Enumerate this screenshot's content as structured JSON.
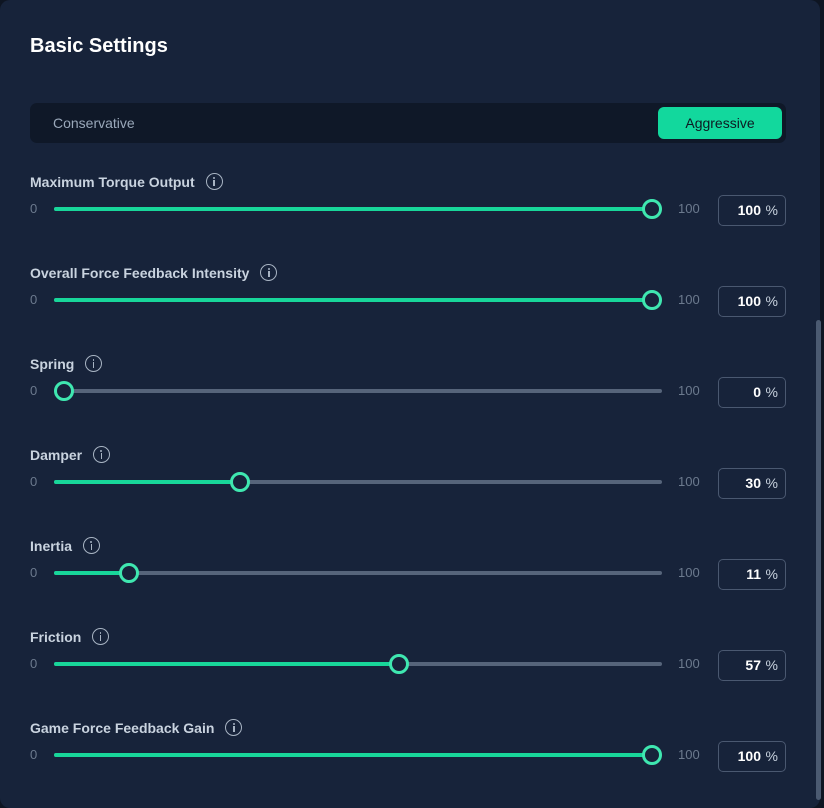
{
  "title": "Basic Settings",
  "mode": {
    "left_label": "Conservative",
    "right_label": "Aggressive",
    "selected": "Aggressive"
  },
  "colors": {
    "accent": "#18d69a",
    "track": "#56647a",
    "panel": "#17233a"
  },
  "settings": [
    {
      "label": "Maximum Torque Output",
      "min": "0",
      "max": "100",
      "value": "100",
      "unit": "%"
    },
    {
      "label": "Overall Force Feedback Intensity",
      "min": "0",
      "max": "100",
      "value": "100",
      "unit": "%"
    },
    {
      "label": "Spring",
      "min": "0",
      "max": "100",
      "value": "0",
      "unit": "%"
    },
    {
      "label": "Damper",
      "min": "0",
      "max": "100",
      "value": "30",
      "unit": "%"
    },
    {
      "label": "Inertia",
      "min": "0",
      "max": "100",
      "value": "11",
      "unit": "%"
    },
    {
      "label": "Friction",
      "min": "0",
      "max": "100",
      "value": "57",
      "unit": "%"
    },
    {
      "label": "Game Force Feedback Gain",
      "min": "0",
      "max": "100",
      "value": "100",
      "unit": "%"
    }
  ],
  "icons": {
    "info": "info-icon"
  }
}
